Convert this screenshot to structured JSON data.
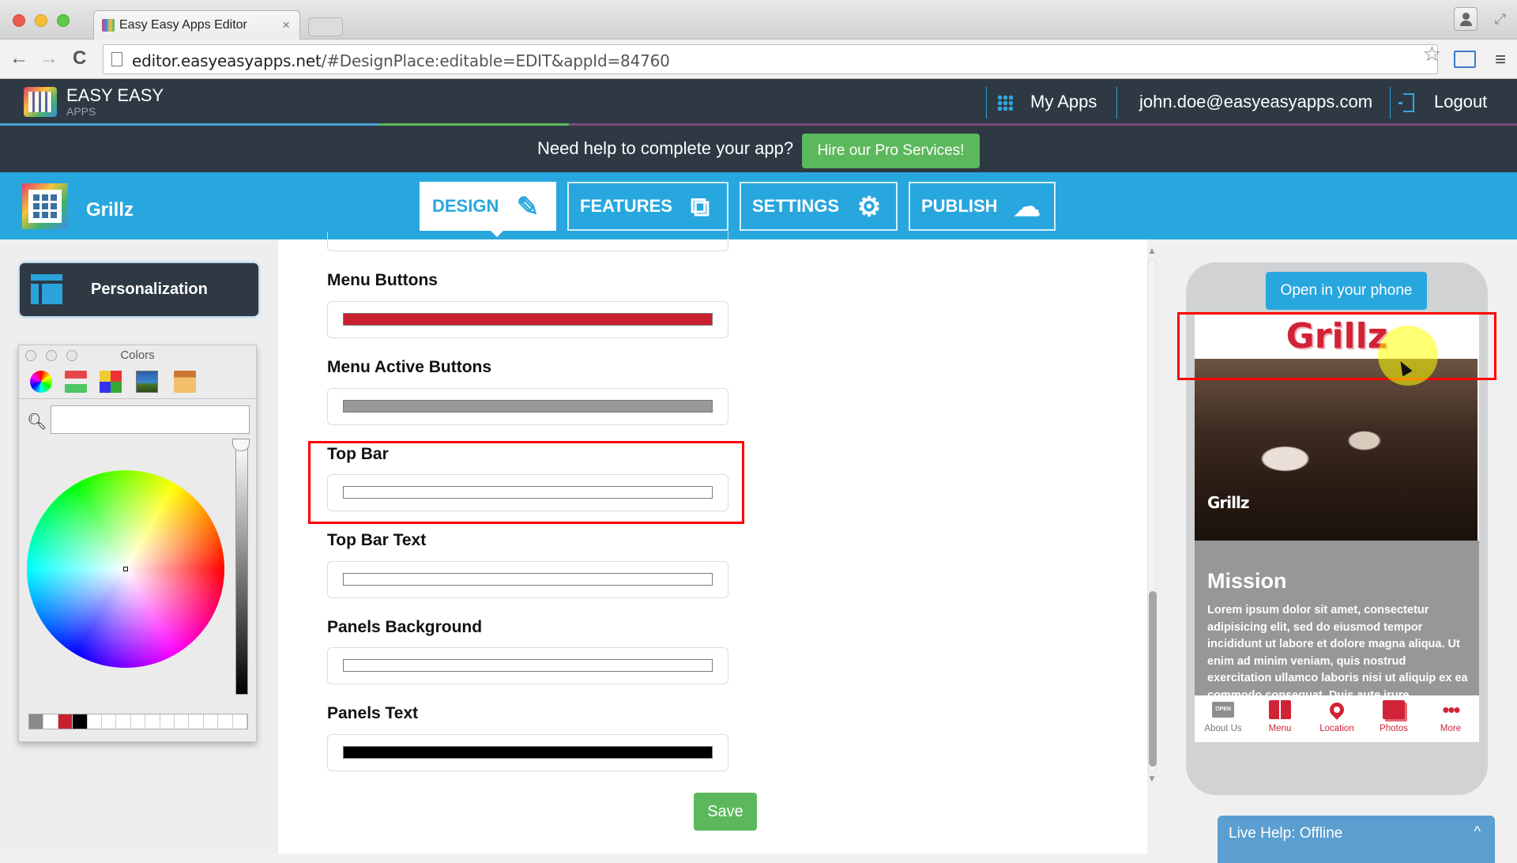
{
  "browser": {
    "tab_title": "Easy Easy Apps Editor",
    "tab_close": "×",
    "url_host": "editor.easyeasyapps.net",
    "url_rest": "/#DesignPlace:editable=EDIT&appId=84760",
    "back": "←",
    "forward": "→",
    "reload": "C",
    "star": "☆",
    "menu": "≡",
    "fullscreen": "⤢"
  },
  "header": {
    "brand_line1": "EASY EASY",
    "brand_line2": "APPS",
    "my_apps": "My Apps",
    "user_email": "john.doe@easyeasyapps.com",
    "logout": "Logout"
  },
  "banner": {
    "text": "Need help to complete your app?",
    "cta": "Hire our Pro Services!"
  },
  "appnav": {
    "app_name": "Grillz",
    "tabs": [
      {
        "label": "DESIGN",
        "icon": "✎",
        "active": true
      },
      {
        "label": "FEATURES",
        "icon": "⧉",
        "active": false
      },
      {
        "label": "SETTINGS",
        "icon": "⚙",
        "active": false
      },
      {
        "label": "PUBLISH",
        "icon": "☁",
        "active": false
      }
    ]
  },
  "sidebar": {
    "personalization": "Personalization"
  },
  "colors_panel": {
    "title": "Colors",
    "search_value": "",
    "swatches": [
      "#8a8a8a",
      "#ffffff",
      "#c8202f",
      "#000000",
      "#ffffff",
      "#ffffff",
      "#ffffff",
      "#ffffff",
      "#ffffff",
      "#ffffff",
      "#ffffff",
      "#ffffff",
      "#ffffff",
      "#ffffff",
      "#ffffff"
    ]
  },
  "fields": [
    {
      "label": "Menu Buttons",
      "color": "#c8202f"
    },
    {
      "label": "Menu Active Buttons",
      "color": "#999999"
    },
    {
      "label": "Top Bar",
      "color": "#ffffff"
    },
    {
      "label": "Top Bar Text",
      "color": "#ffffff"
    },
    {
      "label": "Panels Background",
      "color": "#ffffff"
    },
    {
      "label": "Panels Text",
      "color": "#000000"
    }
  ],
  "save_label": "Save",
  "preview": {
    "open_in_phone": "Open in your phone",
    "logo": "Grillz",
    "photo_label": "Grillz",
    "mission_title": "Mission",
    "mission_text": "Lorem ipsum dolor sit amet, consectetur adipisicing elit, sed do eiusmod tempor incididunt ut labore et dolore magna aliqua. Ut enim ad minim veniam, quis nostrud exercitation ullamco laboris nisi ut aliquip ex ea commodo consequat. Duis aute irure",
    "open_sign": "OPEN",
    "tabs": [
      {
        "label": "About Us",
        "icon": "open-sign"
      },
      {
        "label": "Menu",
        "icon": "book"
      },
      {
        "label": "Location",
        "icon": "map-pin"
      },
      {
        "label": "Photos",
        "icon": "photos"
      },
      {
        "label": "More",
        "icon": "more-dots"
      }
    ],
    "more_dots": "•••"
  },
  "live_help": {
    "label": "Live Help: Offline",
    "chevron": "^"
  },
  "colors": {
    "brand_blue": "#28a7df",
    "header_dark": "#2e3944",
    "green": "#5cb85c",
    "highlight_red": "#ff0000",
    "app_red": "#d12336"
  }
}
